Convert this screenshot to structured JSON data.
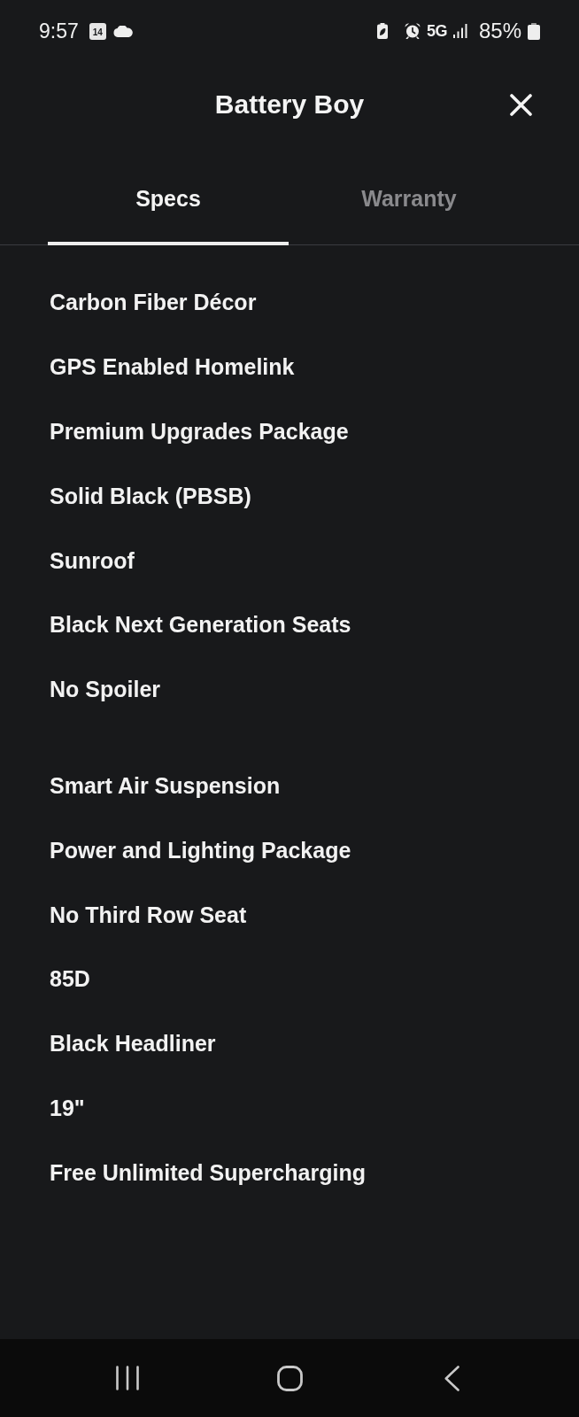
{
  "status_bar": {
    "time": "9:57",
    "calendar_day": "14",
    "network": "5G",
    "battery": "85%"
  },
  "header": {
    "title": "Battery Boy"
  },
  "tabs": [
    {
      "label": "Specs",
      "selected": true
    },
    {
      "label": "Warranty",
      "selected": false
    }
  ],
  "spec_groups": [
    {
      "items": [
        "Carbon Fiber Décor",
        "GPS Enabled Homelink",
        "Premium Upgrades Package",
        "Solid Black (PBSB)",
        "Sunroof",
        "Black Next Generation Seats",
        "No Spoiler"
      ]
    },
    {
      "items": [
        "Smart Air Suspension",
        "Power and Lighting Package",
        "No Third Row Seat",
        "85D",
        "Black Headliner",
        "19\"",
        "Free Unlimited Supercharging"
      ]
    }
  ]
}
